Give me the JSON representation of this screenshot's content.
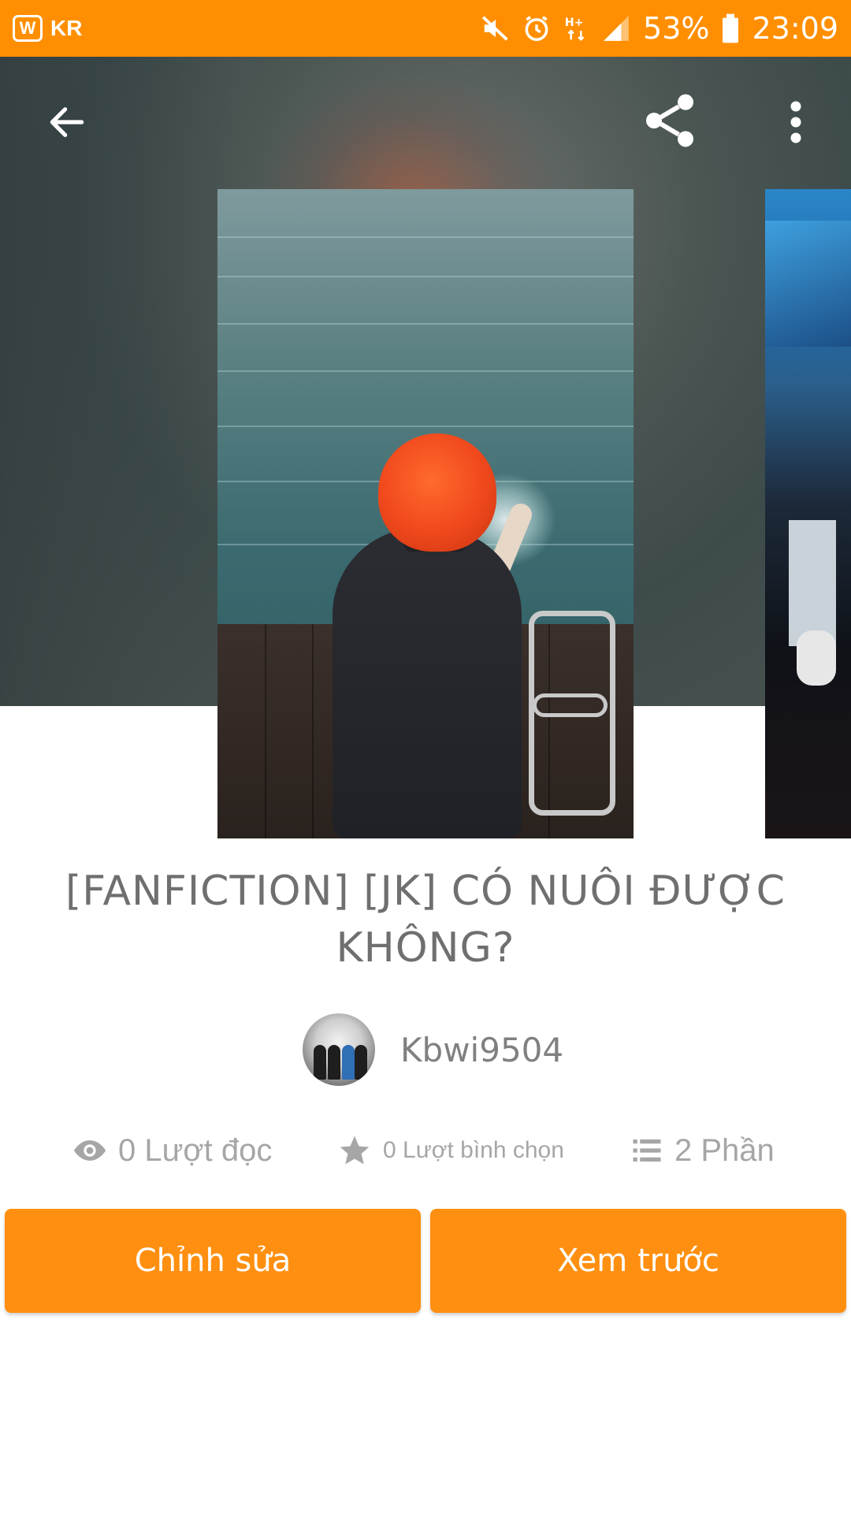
{
  "status_bar": {
    "app_icon": "wattpad-logo",
    "app_letter": "W",
    "carrier": "KR",
    "icons": [
      "mute-icon",
      "alarm-icon",
      "network-hplus-icon",
      "signal-icon",
      "battery-icon"
    ],
    "battery": "53%",
    "time": "23:09"
  },
  "header": {
    "back_icon": "back-arrow-icon",
    "share_icon": "share-icon",
    "more_icon": "more-vert-icon"
  },
  "story": {
    "title": "[FANFICTION] [JK] CÓ NUÔI ĐƯỢC KHÔNG?",
    "author": "Kbwi9504",
    "stats": {
      "reads": "0 Lượt đọc",
      "votes": "0 Lượt bình chọn",
      "parts": "2 Phần"
    }
  },
  "actions": {
    "edit_label": "Chỉnh sửa",
    "preview_label": "Xem trước"
  },
  "colors": {
    "accent": "#ff8f00",
    "button": "#ff8f10",
    "text_muted": "#a6a6a6",
    "title_text": "#6f6f6f"
  }
}
